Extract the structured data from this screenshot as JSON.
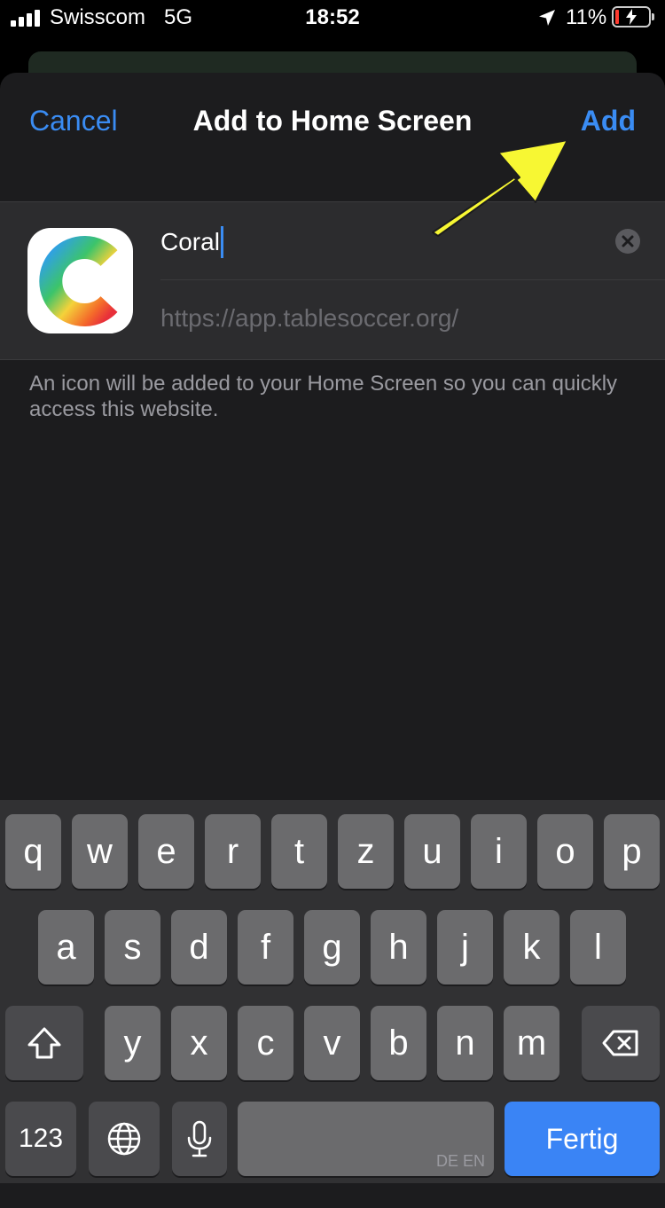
{
  "status_bar": {
    "carrier": "Swisscom",
    "network": "5G",
    "time": "18:52",
    "battery_percent": "11%",
    "battery_level": 0.11,
    "icons": [
      "signal-bars-icon",
      "location-arrow-icon",
      "battery-charging-icon"
    ]
  },
  "nav": {
    "cancel_label": "Cancel",
    "title": "Add to Home Screen",
    "add_label": "Add"
  },
  "form": {
    "name_value": "Coral",
    "url": "https://app.tablesoccer.org/",
    "hint": "An icon will be added to your Home Screen so you can quickly access this website."
  },
  "keyboard": {
    "row1": [
      "q",
      "w",
      "e",
      "r",
      "t",
      "z",
      "u",
      "i",
      "o",
      "p"
    ],
    "row2": [
      "a",
      "s",
      "d",
      "f",
      "g",
      "h",
      "j",
      "k",
      "l"
    ],
    "row3": [
      "y",
      "x",
      "c",
      "v",
      "b",
      "n",
      "m"
    ],
    "numbers_label": "123",
    "space_languages": "DE EN",
    "return_label": "Fertig"
  },
  "colors": {
    "accent": "#3a8cf3",
    "sheet_bg": "#1c1c1e",
    "annotation_arrow": "#f7f733"
  }
}
